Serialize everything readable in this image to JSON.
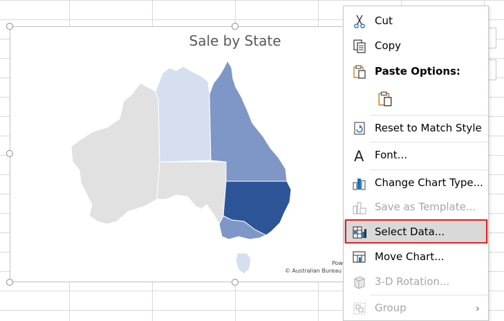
{
  "chart": {
    "title": "Sale by State",
    "attribution_line1": "Powe",
    "attribution_line2": "© Australian Bureau c",
    "state_colors": {
      "western_australia": "#e1e1e1",
      "northern_territory": "#d6dff0",
      "queensland": "#7f97c7",
      "south_australia": "#e1e1e1",
      "new_south_wales": "#2d5497",
      "victoria": "#7f97c7",
      "tasmania": "#d6dff0"
    }
  },
  "context_menu": {
    "items": [
      {
        "label": "Cut",
        "icon": "scissors-icon",
        "disabled": false
      },
      {
        "label": "Copy",
        "icon": "copy-icon",
        "disabled": false
      },
      {
        "label": "Paste Options:",
        "icon": "clipboard-icon",
        "disabled": false,
        "bold": true
      },
      {
        "label": "Reset to Match Style",
        "icon": "reset-style-icon",
        "disabled": false
      },
      {
        "label": "Font...",
        "icon": "font-icon",
        "disabled": false
      },
      {
        "label": "Change Chart Type...",
        "icon": "chart-type-icon",
        "disabled": false
      },
      {
        "label": "Save as Template...",
        "icon": "template-icon",
        "disabled": true
      },
      {
        "label": "Select Data...",
        "icon": "select-data-icon",
        "disabled": false,
        "selected": true
      },
      {
        "label": "Move Chart...",
        "icon": "move-chart-icon",
        "disabled": false
      },
      {
        "label": "3-D Rotation...",
        "icon": "rotation-icon",
        "disabled": true
      },
      {
        "label": "Group",
        "icon": "group-icon",
        "disabled": true
      }
    ],
    "highlight_color": "#e01e1e"
  }
}
